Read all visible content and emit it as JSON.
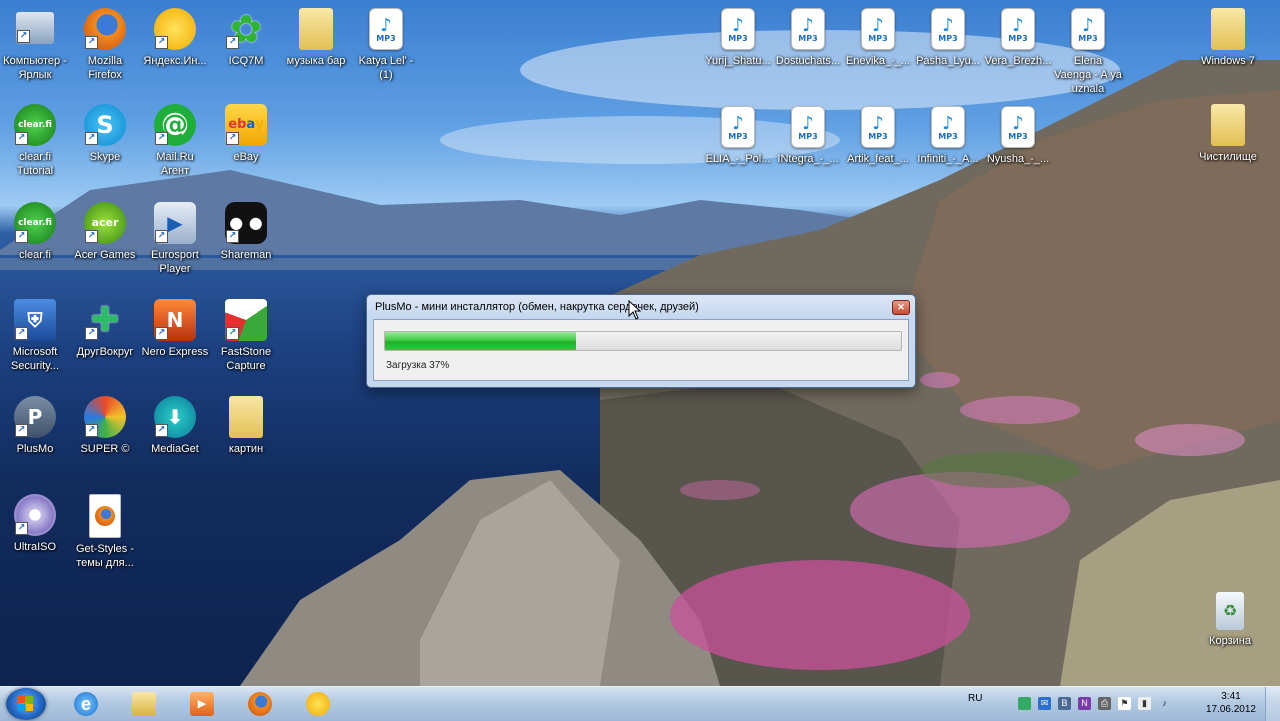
{
  "desktop_icons": [
    {
      "label": "Компьютер - Ярлык",
      "icon": "computer-icon"
    },
    {
      "label": "Mozilla Firefox",
      "icon": "firefox-icon"
    },
    {
      "label": "Яндекс.Ин...",
      "icon": "yandex-icon"
    },
    {
      "label": "ICQ7M",
      "icon": "icq-icon"
    },
    {
      "label": "музыка бар",
      "icon": "folder-icon"
    },
    {
      "label": "Katya Lel' - (1)",
      "icon": "mp3-icon"
    },
    {
      "label": "clear.fi Tutorial",
      "icon": "clearfi-icon"
    },
    {
      "label": "Skype",
      "icon": "skype-icon"
    },
    {
      "label": "Mail.Ru Агент",
      "icon": "mailru-agent-icon"
    },
    {
      "label": "eBay",
      "icon": "ebay-icon"
    },
    {
      "label": "clear.fi",
      "icon": "clearfi-icon"
    },
    {
      "label": "Acer Games",
      "icon": "acer-games-icon"
    },
    {
      "label": "Eurosport Player",
      "icon": "eurosport-icon"
    },
    {
      "label": "Shareman",
      "icon": "shareman-icon"
    },
    {
      "label": "Microsoft Security...",
      "icon": "security-icon"
    },
    {
      "label": "ДругВокруг",
      "icon": "drugvokrug-icon"
    },
    {
      "label": "Nero Express",
      "icon": "nero-icon"
    },
    {
      "label": "FastStone Capture",
      "icon": "faststone-icon"
    },
    {
      "label": "PlusMo",
      "icon": "plusmo-icon"
    },
    {
      "label": "SUPER ©",
      "icon": "super-icon"
    },
    {
      "label": "MediaGet",
      "icon": "mediaget-icon"
    },
    {
      "label": "картин",
      "icon": "folder-icon"
    },
    {
      "label": "UltraISO",
      "icon": "ultraiso-icon"
    },
    {
      "label": "Get-Styles - темы для...",
      "icon": "firefox-file-icon"
    },
    {
      "label": "Yurij_Shatu...",
      "icon": "mp3-icon"
    },
    {
      "label": "Dostuchats...",
      "icon": "mp3-icon"
    },
    {
      "label": "Enevika_-_...",
      "icon": "mp3-icon"
    },
    {
      "label": "Pasha_Lyu...",
      "icon": "mp3-icon"
    },
    {
      "label": "Vera_Brezh...",
      "icon": "mp3-icon"
    },
    {
      "label": "Elena Vaenga - A ya uznala",
      "icon": "mp3-icon"
    },
    {
      "label": "Windows 7",
      "icon": "folder-icon"
    },
    {
      "label": "ELIA_-_Pol...",
      "icon": "mp3-icon"
    },
    {
      "label": "INtegra_-_...",
      "icon": "mp3-icon"
    },
    {
      "label": "Artik_feat_...",
      "icon": "mp3-icon"
    },
    {
      "label": "Infiniti_-_A...",
      "icon": "mp3-icon"
    },
    {
      "label": "Nyusha_-_...",
      "icon": "mp3-icon"
    },
    {
      "label": "Чистилище",
      "icon": "folder-icon"
    },
    {
      "label": "Корзина",
      "icon": "recycle-bin-icon"
    }
  ],
  "mp3_tag": "MP3",
  "dialog": {
    "title": "PlusMo - мини инсталлятор (обмен, накрутка сердечек, друзей)",
    "close": "✕",
    "progress": 0.37,
    "status": "Загрузка 37%"
  },
  "taskbar": {
    "pinned": [
      "internet-explorer-icon",
      "explorer-folder-icon",
      "media-player-icon",
      "firefox-icon",
      "yandex-icon"
    ],
    "language": "RU",
    "time": "3:41",
    "date": "17.06.2012"
  }
}
